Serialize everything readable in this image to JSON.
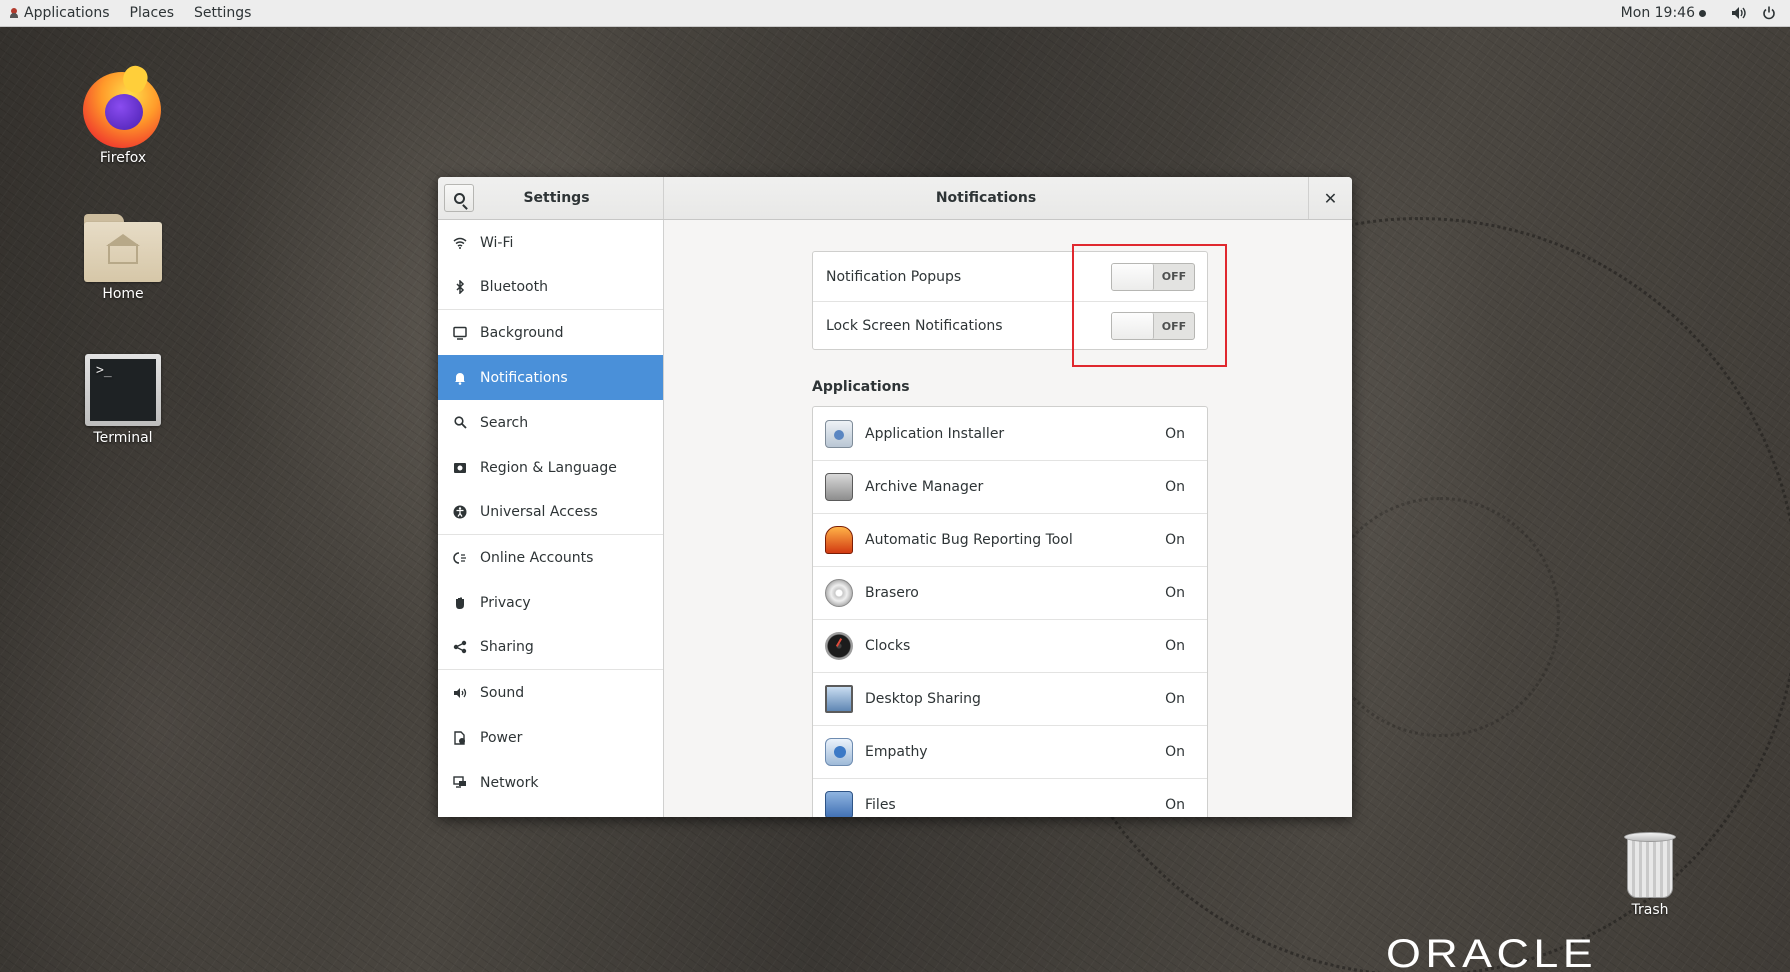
{
  "topbar": {
    "applications": "Applications",
    "places": "Places",
    "settings": "Settings",
    "clock": "Mon 19:46",
    "volume_icon": "volume-icon",
    "power_icon": "power-icon"
  },
  "desktop": {
    "icons": [
      {
        "label": "Firefox",
        "icon": "firefox-icon"
      },
      {
        "label": "Home",
        "icon": "home-folder-icon"
      },
      {
        "label": "Terminal",
        "icon": "terminal-icon"
      },
      {
        "label": "Trash",
        "icon": "trash-icon"
      }
    ],
    "brand": "ORACLE"
  },
  "window": {
    "sidebar_title": "Settings",
    "page_title": "Notifications",
    "close_icon": "close-icon"
  },
  "sidebar": {
    "items": [
      {
        "label": "Wi-Fi",
        "icon": "wifi-icon"
      },
      {
        "label": "Bluetooth",
        "icon": "bluetooth-icon"
      },
      {
        "label": "Background",
        "icon": "background-icon"
      },
      {
        "label": "Notifications",
        "icon": "bell-icon",
        "active": true
      },
      {
        "label": "Search",
        "icon": "search-icon"
      },
      {
        "label": "Region & Language",
        "icon": "region-icon"
      },
      {
        "label": "Universal Access",
        "icon": "accessibility-icon"
      },
      {
        "label": "Online Accounts",
        "icon": "online-accounts-icon"
      },
      {
        "label": "Privacy",
        "icon": "privacy-hand-icon"
      },
      {
        "label": "Sharing",
        "icon": "share-icon"
      },
      {
        "label": "Sound",
        "icon": "sound-icon"
      },
      {
        "label": "Power",
        "icon": "power-plug-icon"
      },
      {
        "label": "Network",
        "icon": "network-icon"
      }
    ]
  },
  "notifications": {
    "popups_label": "Notification Popups",
    "popups_state": "OFF",
    "lock_label": "Lock Screen Notifications",
    "lock_state": "OFF",
    "applications_heading": "Applications",
    "apps": [
      {
        "name": "Application Installer",
        "status": "On"
      },
      {
        "name": "Archive Manager",
        "status": "On"
      },
      {
        "name": "Automatic Bug Reporting Tool",
        "status": "On"
      },
      {
        "name": "Brasero",
        "status": "On"
      },
      {
        "name": "Clocks",
        "status": "On"
      },
      {
        "name": "Desktop Sharing",
        "status": "On"
      },
      {
        "name": "Empathy",
        "status": "On"
      },
      {
        "name": "Files",
        "status": "On"
      }
    ]
  },
  "colors": {
    "accent": "#4a90d9",
    "highlight_box": "#e0282e"
  }
}
